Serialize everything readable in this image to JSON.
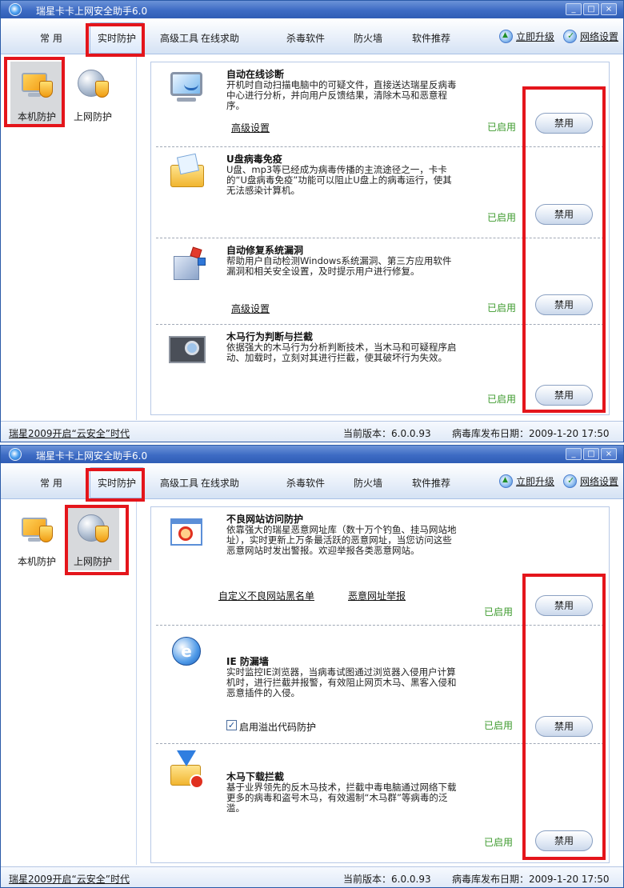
{
  "app": {
    "title": "瑞星卡卡上网安全助手6.0",
    "min_label": "_",
    "max_label": "□",
    "close_label": "×"
  },
  "menu": {
    "items": [
      "常  用",
      "实时防护",
      "高级工具",
      "在线求助",
      "杀毒软件",
      "防火墙",
      "软件推荐"
    ],
    "upgrade": "立即升级",
    "network": "网络设置"
  },
  "nav": {
    "local": "本机防护",
    "online": "上网防护"
  },
  "local_sections": [
    {
      "title": "自动在线诊断",
      "desc": "开机时自动扫描电脑中的可疑文件，直接送达瑞星反病毒中心进行分析，并向用户反馈结果，清除木马和恶意程序。",
      "link": "高级设置",
      "status": "已启用",
      "button": "禁用"
    },
    {
      "title": "U盘病毒免疫",
      "desc": "U盘、mp3等已经成为病毒传播的主流途径之一，卡卡的“U盘病毒免疫”功能可以阻止U盘上的病毒运行，使其无法感染计算机。",
      "status": "已启用",
      "button": "禁用"
    },
    {
      "title": "自动修复系统漏洞",
      "desc": "帮助用户自动检测Windows系统漏洞、第三方应用软件漏洞和相关安全设置，及时提示用户进行修复。",
      "link": "高级设置",
      "status": "已启用",
      "button": "禁用"
    },
    {
      "title": "木马行为判断与拦截",
      "desc": "依据强大的木马行为分析判断技术，当木马和可疑程序启动、加载时，立刻对其进行拦截，使其破坏行为失效。",
      "status": "已启用",
      "button": "禁用"
    }
  ],
  "online_sections": [
    {
      "title": "不良网站访问防护",
      "desc": "依靠强大的瑞星恶意网址库（数十万个钓鱼、挂马网站地址），实时更新上万条最活跃的恶意网址，当您访问这些恶意网站时发出警报。欢迎举报各类恶意网站。",
      "link1": "自定义不良网站黑名单",
      "link2": "恶意网址举报",
      "status": "已启用",
      "button": "禁用"
    },
    {
      "title": "IE 防漏墙",
      "desc": "实时监控IE浏览器，当病毒试图通过浏览器入侵用户计算机时，进行拦截并报警，有效阻止网页木马、黑客入侵和恶意插件的入侵。",
      "checkbox_label": "启用溢出代码防护",
      "checkbox_checked": true,
      "status": "已启用",
      "button": "禁用"
    },
    {
      "title": "木马下载拦截",
      "desc": "基于业界领先的反木马技术，拦截中毒电脑通过网络下载更多的病毒和盗号木马，有效遏制“木马群”等病毒的泛滥。",
      "status": "已启用",
      "button": "禁用"
    }
  ],
  "status_bar": {
    "slogan": "瑞星2009开启“云安全”时代",
    "version": "当前版本：6.0.0.93",
    "db_date": "病毒库发布日期：2009-1-20 17:50"
  },
  "colors": {
    "highlight": "#e4151b",
    "enabled": "#3d9a2d",
    "titlebar": "#3d6bc4"
  },
  "checkbox_mark": "✓"
}
